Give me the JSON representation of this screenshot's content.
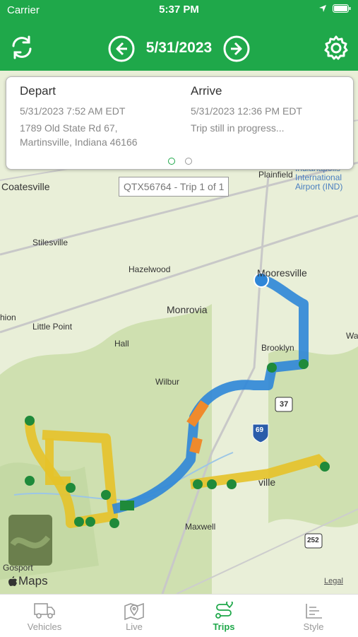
{
  "status_bar": {
    "carrier": "Carrier",
    "time": "5:37 PM"
  },
  "header": {
    "date": "5/31/2023",
    "colors": {
      "brand": "#1fa84a"
    }
  },
  "trip_card": {
    "depart": {
      "heading": "Depart",
      "time": "5/31/2023 7:52 AM EDT",
      "address_line1": "1789 Old State Rd 67,",
      "address_line2": "Martinsville, Indiana 46166"
    },
    "arrive": {
      "heading": "Arrive",
      "time": "5/31/2023 12:36 PM EDT",
      "status": "Trip still in progress..."
    },
    "page_count": 2,
    "active_page": 1
  },
  "trip_label": "QTX56764 - Trip 1 of 1",
  "map": {
    "places": [
      "Coatesville",
      "Plainfield",
      "Indianapolis International Airport (IND)",
      "Stilesville",
      "Hazelwood",
      "Mooresville",
      "Monrovia",
      "Little Point",
      "Brooklyn",
      "Hall",
      "Wilbur",
      "Maxwell",
      "Gosport",
      "ville",
      "hion",
      "Wa"
    ],
    "highway_shields": [
      "37",
      "69",
      "252"
    ],
    "attribution": "Maps",
    "legal": "Legal"
  },
  "tabs": [
    {
      "label": "Vehicles",
      "icon": "truck-icon",
      "active": false
    },
    {
      "label": "Live",
      "icon": "map-pin-icon",
      "active": false
    },
    {
      "label": "Trips",
      "icon": "route-icon",
      "active": true
    },
    {
      "label": "Style",
      "icon": "list-style-icon",
      "active": false
    }
  ]
}
